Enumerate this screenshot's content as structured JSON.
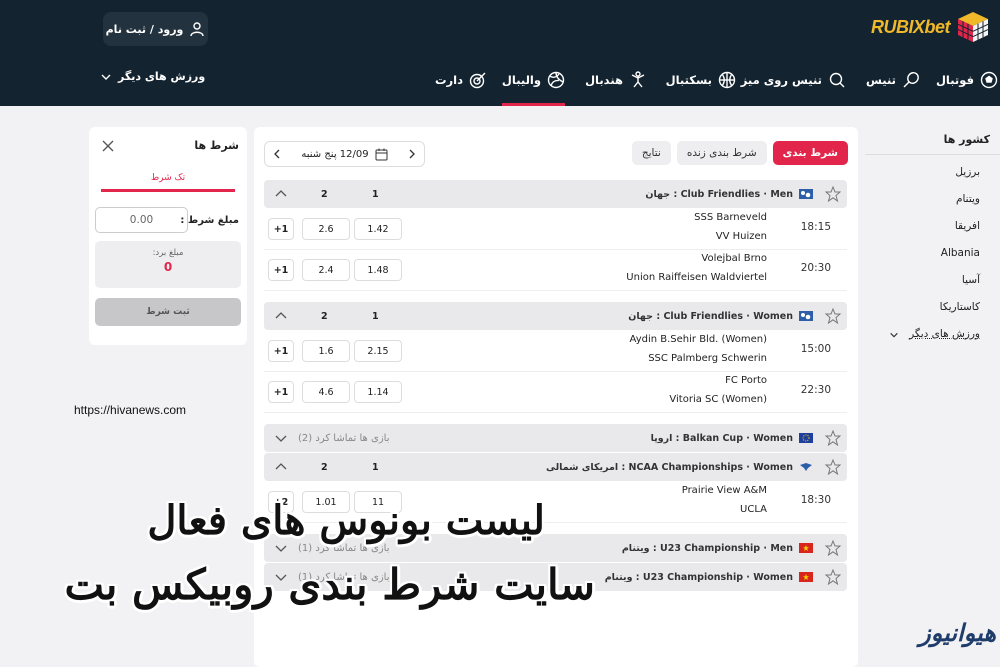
{
  "header": {
    "logo_text": "RUBIXbet",
    "login_label": "ورود / ثبت نام",
    "nav": [
      {
        "label": "فوتبال",
        "icon": "football-icon"
      },
      {
        "label": "تنیس",
        "icon": "tennis-icon"
      },
      {
        "label": "تنیس روی میز",
        "icon": "table-tennis-icon"
      },
      {
        "label": "بسکتبال",
        "icon": "basketball-icon"
      },
      {
        "label": "هندبال",
        "icon": "handball-icon"
      },
      {
        "label": "والیبال",
        "icon": "volleyball-icon",
        "active": true
      },
      {
        "label": "دارت",
        "icon": "darts-icon"
      }
    ],
    "more_sports": "ورزش های دیگر"
  },
  "sidebar": {
    "title": "کشور ها",
    "countries": [
      "برزیل",
      "ویتنام",
      "افریقا",
      "Albania",
      "آسیا",
      "کاستاریکا"
    ],
    "more": "ورزش های دیگر"
  },
  "main": {
    "tabs": [
      "شرط بندی",
      "شرط بندی زنده",
      "نتایج"
    ],
    "date": "12/09 پنج شنبه",
    "leagues": [
      {
        "name": "Club Friendlies · Men : جهان",
        "col1": "1",
        "col2": "2",
        "matches": [
          {
            "time": "18:15",
            "team1": "SSS Barneveld",
            "team2": "VV Huizen",
            "odd1": "1.42",
            "odd2": "2.6",
            "more": "+1"
          },
          {
            "time": "20:30",
            "team1": "Volejbal Brno",
            "team2": "Union Raiffeisen Waldviertel",
            "odd1": "1.48",
            "odd2": "2.4",
            "more": "+1"
          }
        ]
      },
      {
        "name": "Club Friendlies · Women : جهان",
        "col1": "1",
        "col2": "2",
        "matches": [
          {
            "time": "15:00",
            "team1": "Aydin B.Sehir Bld. (Women)",
            "team2": "SSC Palmberg Schwerin",
            "odd1": "2.15",
            "odd2": "1.6",
            "more": "+1"
          },
          {
            "time": "22:30",
            "team1": "FC Porto",
            "team2": "Vitoria SC (Women)",
            "odd1": "1.14",
            "odd2": "4.6",
            "more": "+1"
          }
        ]
      },
      {
        "name": "Balkan Cup · Women : اروپا",
        "watched": "بازی ها تماشا کرد (2)"
      },
      {
        "name": "NCAA Championships · Women : امریکای شمالی",
        "col1": "1",
        "col2": "2",
        "matches": [
          {
            "time": "18:30",
            "team1": "Prairie View A&M",
            "team2": "UCLA",
            "odd1": "11",
            "odd2": "1.01",
            "more": "+2"
          }
        ]
      },
      {
        "name": "U23 Championship · Men : ویتنام",
        "watched": "بازی ها تماشا کرد (1)"
      },
      {
        "name": "U23 Championship · Women : ویتنام",
        "watched": "بازی ها تماشا کرد (1)"
      }
    ]
  },
  "betslip": {
    "title": "شرط ها",
    "tab": "تک شرط",
    "amount_label": "مبلغ شرط :",
    "amount_value": "0.00",
    "win_label": "مبلغ برد:",
    "win_value": "0",
    "submit": "ثبت شرط"
  },
  "overlay": {
    "url": "https://hivanews.com",
    "line1": "لیست بونوس های فعال",
    "line2": "سایت شرط بندی روبیکس بت",
    "watermark": "هیوانیوز"
  },
  "colors": {
    "accent": "#e2254a",
    "header_bg": "#13232f",
    "logo": "#f0b92a"
  }
}
